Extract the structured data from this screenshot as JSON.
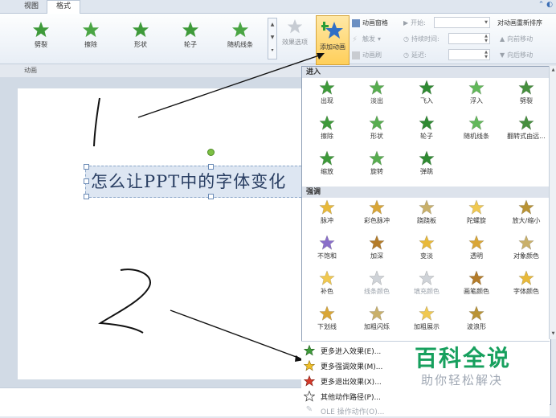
{
  "tabs": {
    "view": "视图",
    "format": "格式"
  },
  "ribbon": {
    "effects": [
      "劈裂",
      "擦除",
      "形状",
      "轮子",
      "随机线条"
    ],
    "effect_options": "效果选项",
    "add_animation": "添加动画",
    "animation_pane": "动画窗格",
    "trigger": "触发",
    "animation_painter": "动画刷",
    "start_label": "开始:",
    "duration_label": "持续时间:",
    "delay_label": "延迟:",
    "reorder_title": "对动画重新排序",
    "move_earlier": "向前移动",
    "move_later": "向后移动",
    "group_label": "动画"
  },
  "slide": {
    "title_text": "怎么让PPT中的字体变化",
    "note_1": "1",
    "note_2": "2"
  },
  "panel": {
    "entrance_header": "进入",
    "entrance": [
      "出现",
      "淡出",
      "飞入",
      "浮入",
      "劈裂",
      "擦除",
      "形状",
      "轮子",
      "随机线条",
      "翻转式由远...",
      "缩放",
      "旋转",
      "弹跳"
    ],
    "emphasis_header": "强调",
    "emphasis": [
      "脉冲",
      "彩色脉冲",
      "跷跷板",
      "陀螺旋",
      "放大/缩小",
      "不饱和",
      "加深",
      "变淡",
      "透明",
      "对象颜色",
      "补色",
      "线条颜色",
      "填充颜色",
      "画笔颜色",
      "字体颜色",
      "下划线",
      "加粗闪烁",
      "加粗展示",
      "波浪形"
    ],
    "more_menu": [
      "更多进入效果(E)...",
      "更多强调效果(M)...",
      "更多退出效果(X)...",
      "其他动作路径(P)...",
      "OLE 操作动作(O)..."
    ]
  },
  "watermark": {
    "title": "百科全说",
    "subtitle": "助你轻松解决"
  },
  "colors": {
    "entrance_star": "#3e9a3a",
    "highlight": "#ffcf5a",
    "watermark": "#17a05e"
  }
}
